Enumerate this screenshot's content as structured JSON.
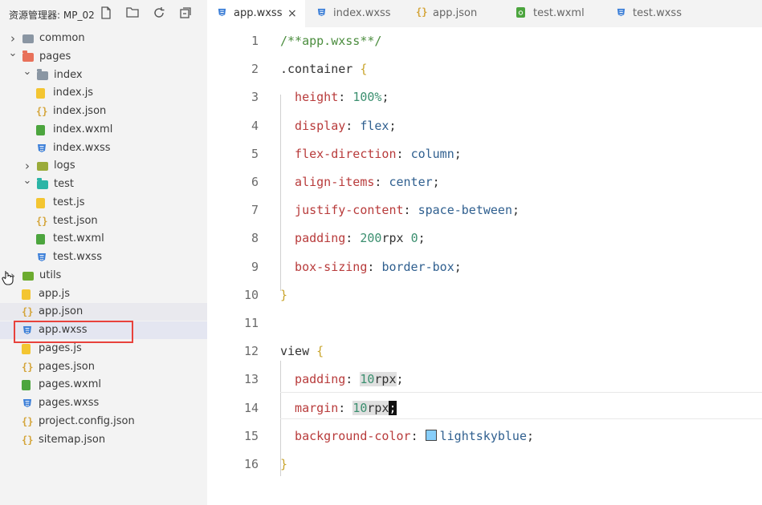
{
  "explorer": {
    "title": "资源管理器: MP_02",
    "tools": [
      "new-file-icon",
      "new-folder-icon",
      "refresh-icon",
      "collapse-icon"
    ],
    "items": [
      {
        "label": "common",
        "type": "folder",
        "depth": 0,
        "expanded": false
      },
      {
        "label": "pages",
        "type": "folder",
        "depth": 0,
        "expanded": true
      },
      {
        "label": "index",
        "type": "folder",
        "depth": 1,
        "expanded": true
      },
      {
        "label": "index.js",
        "type": "js",
        "depth": 2
      },
      {
        "label": "index.json",
        "type": "json",
        "depth": 2
      },
      {
        "label": "index.wxml",
        "type": "wxml",
        "depth": 2
      },
      {
        "label": "index.wxss",
        "type": "wxss",
        "depth": 2
      },
      {
        "label": "logs",
        "type": "folder",
        "depth": 1,
        "expanded": false
      },
      {
        "label": "test",
        "type": "folder",
        "depth": 1,
        "expanded": true
      },
      {
        "label": "test.js",
        "type": "js",
        "depth": 2
      },
      {
        "label": "test.json",
        "type": "json",
        "depth": 2
      },
      {
        "label": "test.wxml",
        "type": "wxml",
        "depth": 2
      },
      {
        "label": "test.wxss",
        "type": "wxss",
        "depth": 2
      },
      {
        "label": "utils",
        "type": "folder",
        "depth": 0,
        "expanded": false
      },
      {
        "label": "app.js",
        "type": "js",
        "depth": 0
      },
      {
        "label": "app.json",
        "type": "json",
        "depth": 0
      },
      {
        "label": "app.wxss",
        "type": "wxss",
        "depth": 0,
        "selected": true
      },
      {
        "label": "pages.js",
        "type": "js",
        "depth": 0
      },
      {
        "label": "pages.json",
        "type": "json",
        "depth": 0
      },
      {
        "label": "pages.wxml",
        "type": "wxml",
        "depth": 0
      },
      {
        "label": "pages.wxss",
        "type": "wxss",
        "depth": 0
      },
      {
        "label": "project.config.json",
        "type": "json",
        "depth": 0
      },
      {
        "label": "sitemap.json",
        "type": "json",
        "depth": 0
      }
    ]
  },
  "tabs": [
    {
      "label": "app.wxss",
      "type": "wxss",
      "active": true,
      "close": "×"
    },
    {
      "label": "index.wxss",
      "type": "wxss"
    },
    {
      "label": "app.json",
      "type": "json"
    },
    {
      "label": "test.wxml",
      "type": "wxml"
    },
    {
      "label": "test.wxss",
      "type": "wxss"
    }
  ],
  "editor": {
    "lines": [
      {
        "n": "1",
        "tokens": [
          [
            "c-comment",
            "/**app.wxss**/"
          ]
        ]
      },
      {
        "n": "2",
        "tokens": [
          [
            "c-sel",
            ".container "
          ],
          [
            "c-brace",
            "{"
          ]
        ]
      },
      {
        "n": "3",
        "tokens": [
          [
            "c-prop",
            "  height"
          ],
          [
            "c-punct",
            ": "
          ],
          [
            "c-num",
            "100%"
          ],
          [
            "c-punct",
            ";"
          ]
        ]
      },
      {
        "n": "4",
        "tokens": [
          [
            "c-prop",
            "  display"
          ],
          [
            "c-punct",
            ": "
          ],
          [
            "c-val",
            "flex"
          ],
          [
            "c-punct",
            ";"
          ]
        ]
      },
      {
        "n": "5",
        "tokens": [
          [
            "c-prop",
            "  flex-direction"
          ],
          [
            "c-punct",
            ": "
          ],
          [
            "c-val",
            "column"
          ],
          [
            "c-punct",
            ";"
          ]
        ]
      },
      {
        "n": "6",
        "tokens": [
          [
            "c-prop",
            "  align-items"
          ],
          [
            "c-punct",
            ": "
          ],
          [
            "c-val",
            "center"
          ],
          [
            "c-punct",
            ";"
          ]
        ]
      },
      {
        "n": "7",
        "tokens": [
          [
            "c-prop",
            "  justify-content"
          ],
          [
            "c-punct",
            ": "
          ],
          [
            "c-val",
            "space-between"
          ],
          [
            "c-punct",
            ";"
          ]
        ]
      },
      {
        "n": "8",
        "tokens": [
          [
            "c-prop",
            "  padding"
          ],
          [
            "c-punct",
            ": "
          ],
          [
            "c-num",
            "200"
          ],
          [
            "c-unit",
            "rpx "
          ],
          [
            "c-num",
            "0"
          ],
          [
            "c-punct",
            ";"
          ]
        ]
      },
      {
        "n": "9",
        "tokens": [
          [
            "c-prop",
            "  box-sizing"
          ],
          [
            "c-punct",
            ": "
          ],
          [
            "c-val",
            "border-box"
          ],
          [
            "c-punct",
            ";"
          ]
        ]
      },
      {
        "n": "10",
        "tokens": [
          [
            "c-brace",
            "}"
          ]
        ]
      },
      {
        "n": "11",
        "tokens": []
      },
      {
        "n": "12",
        "tokens": [
          [
            "c-sel",
            "view "
          ],
          [
            "c-brace",
            "{"
          ]
        ]
      },
      {
        "n": "13",
        "tokens": [
          [
            "c-prop",
            "  padding"
          ],
          [
            "c-punct",
            ": "
          ],
          [
            "c-num numhl",
            "10"
          ],
          [
            "c-unit numhl",
            "rpx"
          ],
          [
            "c-punct",
            ";"
          ]
        ]
      },
      {
        "n": "14",
        "tokens": [
          [
            "c-prop",
            "  margin"
          ],
          [
            "c-punct",
            ": "
          ],
          [
            "c-num numhl",
            "10"
          ],
          [
            "c-unit numhl",
            "rpx"
          ],
          [
            "c-punct caret-block",
            ";"
          ]
        ]
      },
      {
        "n": "15",
        "tokens": [
          [
            "c-prop",
            "  background-color"
          ],
          [
            "c-punct",
            ": "
          ],
          [
            "swatch",
            ""
          ],
          [
            "c-val",
            "lightskyblue"
          ],
          [
            "c-punct",
            ";"
          ]
        ]
      },
      {
        "n": "16",
        "tokens": [
          [
            "c-brace",
            "}"
          ]
        ]
      }
    ],
    "swatch_color": "#87cefa"
  }
}
